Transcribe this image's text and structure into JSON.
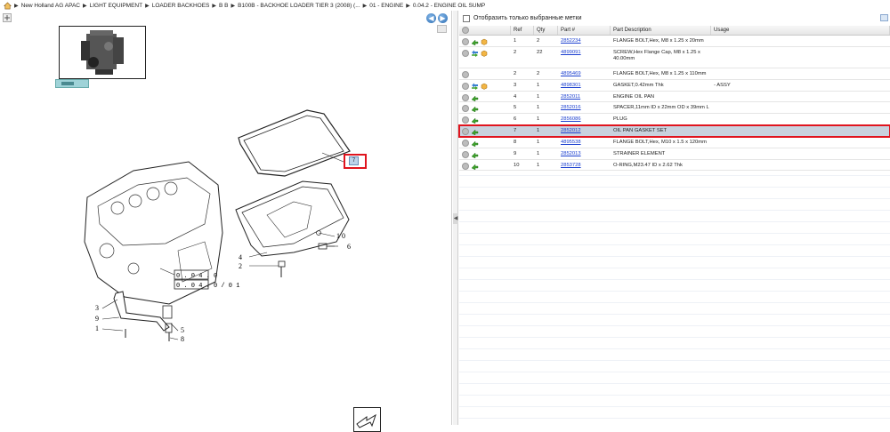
{
  "breadcrumb": [
    "New Holland AG APAC",
    "LIGHT EQUIPMENT",
    "LOADER BACKHOES",
    "B B",
    "B100B - BACKHOE LOADER TIER 3 (2008) (...",
    "01 - ENGINE",
    "0.04.2 - ENGINE OIL SUMP"
  ],
  "filter": {
    "label": "Отобразить только выбранные метки"
  },
  "grid": {
    "headers": [
      "",
      "Ref",
      "Qty",
      "Part #",
      "Part Description",
      "Usage"
    ],
    "rows": [
      {
        "ref": "1",
        "qty": "2",
        "part": "2852234",
        "desc": "FLANGE BOLT,Hex, M8 x 1.25 x 20mm",
        "usage": "",
        "icons": [
          "info",
          "arrow",
          "box"
        ]
      },
      {
        "ref": "2",
        "qty": "22",
        "part": "4899091",
        "desc": "SCREW,Hex Flange Cap, M8 x 1.25 x 40.00mm",
        "usage": "",
        "icons": [
          "info",
          "swap",
          "box"
        ]
      },
      {
        "ref": "2",
        "qty": "2",
        "part": "4895469",
        "desc": "FLANGE BOLT,Hex, M8 x 1.25 x 110mm",
        "usage": "",
        "icons": [
          "info"
        ]
      },
      {
        "ref": "3",
        "qty": "1",
        "part": "4898301",
        "desc": "GASKET,0.42mm Thk",
        "usage": "- ASSY",
        "icons": [
          "info",
          "swap",
          "box"
        ]
      },
      {
        "ref": "4",
        "qty": "1",
        "part": "2852011",
        "desc": "ENGINE OIL PAN",
        "usage": "",
        "icons": [
          "info",
          "arrow"
        ]
      },
      {
        "ref": "5",
        "qty": "1",
        "part": "2852016",
        "desc": "SPACER,11mm ID x 22mm OD x 39mm L",
        "usage": "",
        "icons": [
          "info",
          "arrow"
        ]
      },
      {
        "ref": "6",
        "qty": "1",
        "part": "2856086",
        "desc": "PLUG",
        "usage": "",
        "icons": [
          "info",
          "arrow"
        ]
      },
      {
        "ref": "7",
        "qty": "1",
        "part": "2852012",
        "desc": "OIL PAN GASKET SET",
        "usage": "",
        "icons": [
          "info",
          "arrow"
        ],
        "selected": true
      },
      {
        "ref": "8",
        "qty": "1",
        "part": "4895538",
        "desc": "FLANGE BOLT,Hex, M10 x 1.5 x 120mm",
        "usage": "",
        "icons": [
          "info",
          "arrow"
        ]
      },
      {
        "ref": "9",
        "qty": "1",
        "part": "2852013",
        "desc": "STRAINER ELEMENT",
        "usage": "",
        "icons": [
          "info",
          "arrow"
        ]
      },
      {
        "ref": "10",
        "qty": "1",
        "part": "2853728",
        "desc": "O-RING,M23.47 ID x 2.62 Thk",
        "usage": "",
        "icons": [
          "info",
          "arrow"
        ]
      }
    ]
  },
  "diagram": {
    "callout_selected": "7",
    "labels": [
      "1 0",
      "6",
      "4",
      "2",
      "0 . 0 4 . 0",
      "0 . 0 4 . 0 / 0 1",
      "3",
      "9",
      "1",
      "5",
      "8"
    ]
  },
  "colors": {
    "selected_row": "#c9d2de",
    "highlight_border": "#e0141e",
    "link": "#1a3ecf"
  }
}
